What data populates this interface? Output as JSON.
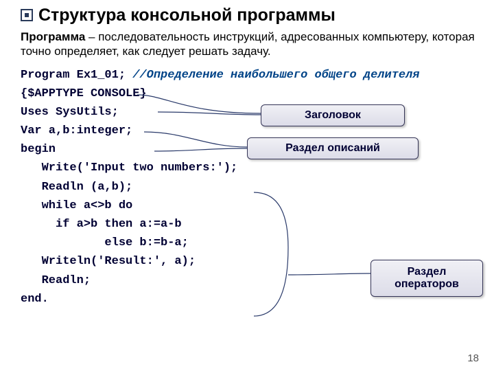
{
  "title": "Структура консольной программы",
  "subtitle_bold": "Программа",
  "subtitle_rest": " – последовательность инструкций, адресованных компьютеру, которая точно определяет, как следует решать задачу.",
  "code": {
    "l1a": "Program Ex1_01;",
    "l1b": " //Определение наибольшего общего делителя",
    "l2": "{$APPTYPE CONSOLE}",
    "l3": "Uses SysUtils;",
    "l4": "Var a,b:integer;",
    "l5": "begin",
    "l6": "   Write('Input two numbers:');",
    "l7": "   Readln (a,b);",
    "l8": "   while a<>b do",
    "l9": "     if a>b then a:=a-b",
    "l10": "            else b:=b-a;",
    "l11": "   Writeln('Result:', a);",
    "l12": "   Readln;",
    "l13": "end."
  },
  "labels": {
    "header": "Заголовок",
    "decls": "Раздел описаний",
    "ops": "Раздел операторов"
  },
  "page_number": "18"
}
